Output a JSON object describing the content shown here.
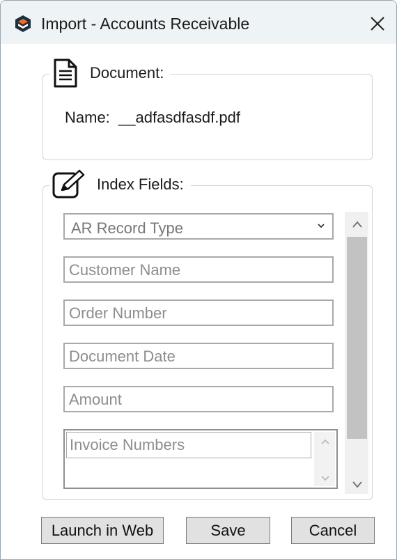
{
  "window": {
    "title": "Import - Accounts Receivable"
  },
  "document_group": {
    "title": "Document:",
    "name_label": "Name:",
    "name_value": "__adfasdfasdf.pdf"
  },
  "index_group": {
    "title": "Index Fields:",
    "record_type": {
      "placeholder": "AR Record Type"
    },
    "fields": {
      "customer_name": "Customer Name",
      "order_number": "Order Number",
      "document_date": "Document Date",
      "amount": "Amount",
      "invoice_numbers": "Invoice Numbers"
    }
  },
  "buttons": {
    "launch_web": "Launch in Web",
    "save": "Save",
    "cancel": "Cancel"
  },
  "icons": {
    "app": "app-logo-icon",
    "close": "close-icon",
    "document": "document-icon",
    "edit": "edit-icon",
    "dropdown": "chevron-down-icon",
    "scroll_up": "chevron-up-icon",
    "scroll_down": "chevron-down-icon"
  },
  "colors": {
    "titlebar": "#eef3f5",
    "logo_accent": "#f26b21",
    "button": "#e1e1e1",
    "scroll_thumb": "#c2c2c2"
  }
}
